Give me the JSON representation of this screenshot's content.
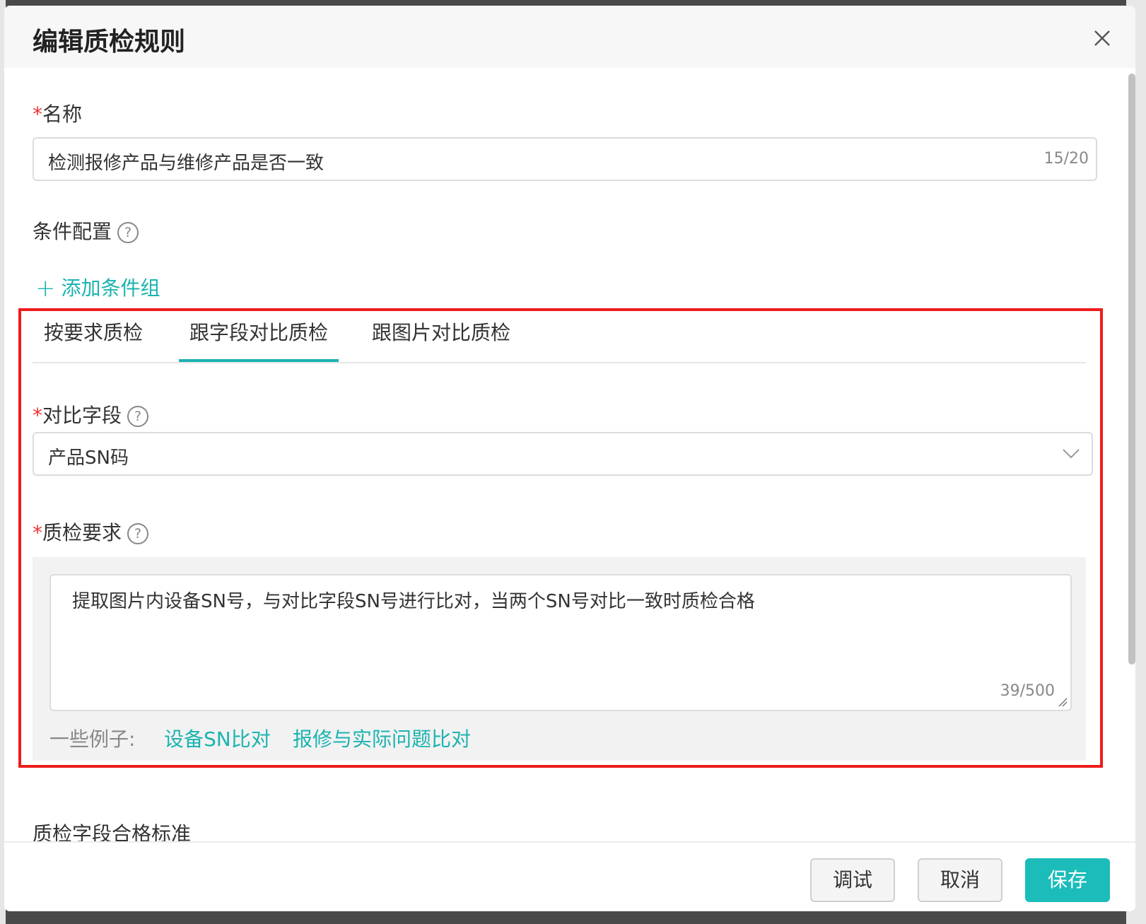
{
  "dialog": {
    "title": "编辑质检规则"
  },
  "name_field": {
    "required_mark": "*",
    "label": "名称",
    "value": "检测报修产品与维修产品是否一致",
    "counter": "15/20"
  },
  "condition": {
    "label": "条件配置",
    "add_group_label": "添加条件组"
  },
  "tabs": [
    {
      "label": "按要求质检",
      "active": false
    },
    {
      "label": "跟字段对比质检",
      "active": true
    },
    {
      "label": "跟图片对比质检",
      "active": false
    }
  ],
  "compare_field": {
    "required_mark": "*",
    "label": "对比字段",
    "value": "产品SN码"
  },
  "requirement": {
    "required_mark": "*",
    "label": "质检要求",
    "value": "提取图片内设备SN号，与对比字段SN号进行比对，当两个SN号对比一致时质检合格",
    "counter": "39/500",
    "examples_label": "一些例子:",
    "examples": [
      "设备SN比对",
      "报修与实际问题比对"
    ]
  },
  "next_section_label": "质检字段合格标准",
  "footer": {
    "debug_label": "调试",
    "cancel_label": "取消",
    "save_label": "保存"
  },
  "colors": {
    "accent": "#1bb3b0",
    "highlight_frame": "#ee1c1c",
    "required": "#e33333"
  },
  "icons": {
    "close": "close-icon",
    "help": "help-circle-icon",
    "plus": "plus-icon",
    "dropdown": "chevron-down-icon",
    "resize": "resize-handle-icon"
  }
}
